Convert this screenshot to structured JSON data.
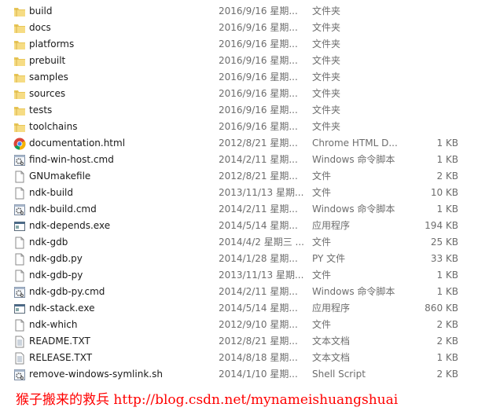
{
  "files": [
    {
      "name": "build",
      "date": "2016/9/16 星期...",
      "type": "文件夹",
      "size": "",
      "icon": "folder"
    },
    {
      "name": "docs",
      "date": "2016/9/16 星期...",
      "type": "文件夹",
      "size": "",
      "icon": "folder"
    },
    {
      "name": "platforms",
      "date": "2016/9/16 星期...",
      "type": "文件夹",
      "size": "",
      "icon": "folder"
    },
    {
      "name": "prebuilt",
      "date": "2016/9/16 星期...",
      "type": "文件夹",
      "size": "",
      "icon": "folder"
    },
    {
      "name": "samples",
      "date": "2016/9/16 星期...",
      "type": "文件夹",
      "size": "",
      "icon": "folder"
    },
    {
      "name": "sources",
      "date": "2016/9/16 星期...",
      "type": "文件夹",
      "size": "",
      "icon": "folder"
    },
    {
      "name": "tests",
      "date": "2016/9/16 星期...",
      "type": "文件夹",
      "size": "",
      "icon": "folder"
    },
    {
      "name": "toolchains",
      "date": "2016/9/16 星期...",
      "type": "文件夹",
      "size": "",
      "icon": "folder"
    },
    {
      "name": "documentation.html",
      "date": "2012/8/21 星期...",
      "type": "Chrome HTML D...",
      "size": "1 KB",
      "icon": "chrome"
    },
    {
      "name": "find-win-host.cmd",
      "date": "2014/2/11 星期...",
      "type": "Windows 命令脚本",
      "size": "1 KB",
      "icon": "script"
    },
    {
      "name": "GNUmakefile",
      "date": "2012/8/21 星期...",
      "type": "文件",
      "size": "2 KB",
      "icon": "file"
    },
    {
      "name": "ndk-build",
      "date": "2013/11/13 星期...",
      "type": "文件",
      "size": "10 KB",
      "icon": "file"
    },
    {
      "name": "ndk-build.cmd",
      "date": "2014/2/11 星期...",
      "type": "Windows 命令脚本",
      "size": "1 KB",
      "icon": "script"
    },
    {
      "name": "ndk-depends.exe",
      "date": "2014/5/14 星期...",
      "type": "应用程序",
      "size": "194 KB",
      "icon": "exe"
    },
    {
      "name": "ndk-gdb",
      "date": "2014/4/2 星期三 ...",
      "type": "文件",
      "size": "25 KB",
      "icon": "file"
    },
    {
      "name": "ndk-gdb.py",
      "date": "2014/1/28 星期...",
      "type": "PY 文件",
      "size": "33 KB",
      "icon": "file"
    },
    {
      "name": "ndk-gdb-py",
      "date": "2013/11/13 星期...",
      "type": "文件",
      "size": "1 KB",
      "icon": "file"
    },
    {
      "name": "ndk-gdb-py.cmd",
      "date": "2014/2/11 星期...",
      "type": "Windows 命令脚本",
      "size": "1 KB",
      "icon": "script"
    },
    {
      "name": "ndk-stack.exe",
      "date": "2014/5/14 星期...",
      "type": "应用程序",
      "size": "860 KB",
      "icon": "exe"
    },
    {
      "name": "ndk-which",
      "date": "2012/9/10 星期...",
      "type": "文件",
      "size": "2 KB",
      "icon": "file"
    },
    {
      "name": "README.TXT",
      "date": "2012/8/21 星期...",
      "type": "文本文档",
      "size": "2 KB",
      "icon": "text"
    },
    {
      "name": "RELEASE.TXT",
      "date": "2014/8/18 星期...",
      "type": "文本文档",
      "size": "1 KB",
      "icon": "text"
    },
    {
      "name": "remove-windows-symlink.sh",
      "date": "2014/1/10 星期...",
      "type": "Shell Script",
      "size": "2 KB",
      "icon": "script"
    }
  ],
  "watermark": "猴子搬来的救兵 http://blog.csdn.net/mynameishuangshuai"
}
